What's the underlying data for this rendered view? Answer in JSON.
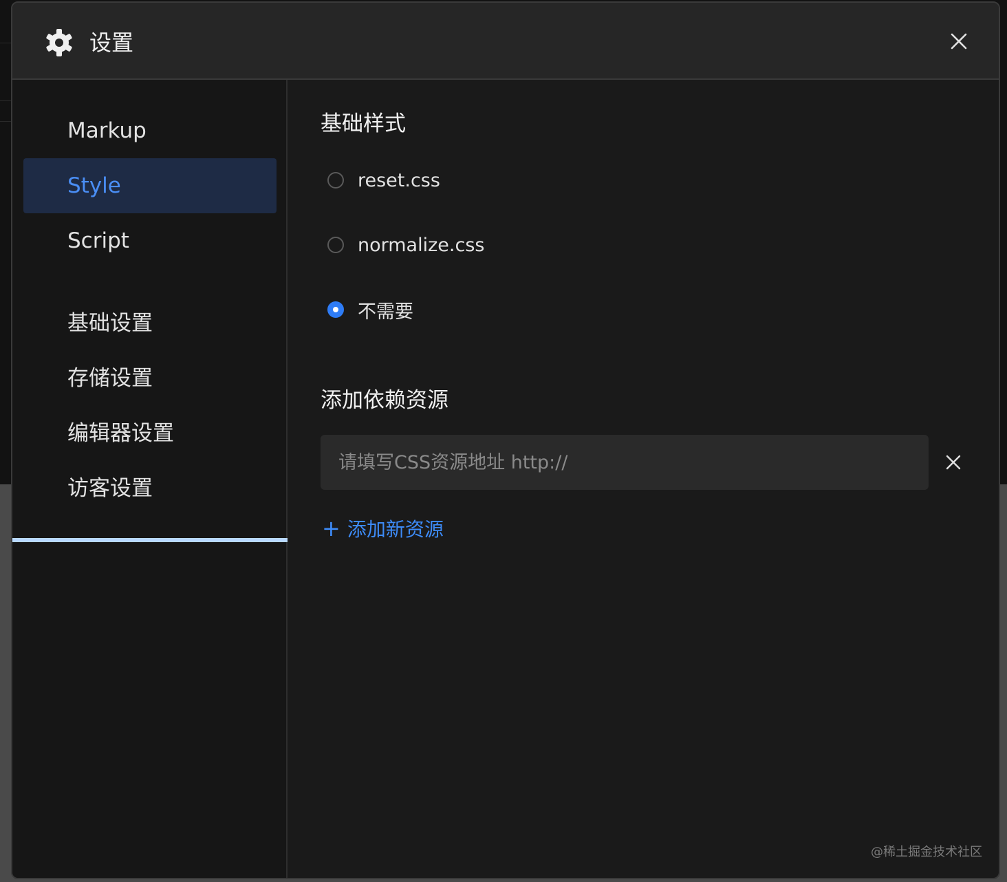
{
  "header": {
    "title": "设置",
    "icon": "gear-icon",
    "close_icon": "close-icon"
  },
  "sidebar": {
    "items": [
      {
        "label": "Markup",
        "active": false
      },
      {
        "label": "Style",
        "active": true
      },
      {
        "label": "Script",
        "active": false
      },
      {
        "label": "基础设置",
        "active": false
      },
      {
        "label": "存储设置",
        "active": false
      },
      {
        "label": "编辑器设置",
        "active": false
      },
      {
        "label": "访客设置",
        "active": false
      }
    ]
  },
  "main": {
    "base_style": {
      "title": "基础样式",
      "options": [
        {
          "label": "reset.css",
          "checked": false
        },
        {
          "label": "normalize.css",
          "checked": false
        },
        {
          "label": "不需要",
          "checked": true
        }
      ]
    },
    "dependencies": {
      "title": "添加依赖资源",
      "input_value": "",
      "input_placeholder": "请填写CSS资源地址 http://",
      "add_label": "添加新资源"
    }
  },
  "watermark": "@稀土掘金技术社区",
  "colors": {
    "accent": "#3d8bf7",
    "active_bg": "#1e2b45",
    "modal_bg": "#1a1a1a",
    "header_bg": "#262626"
  }
}
